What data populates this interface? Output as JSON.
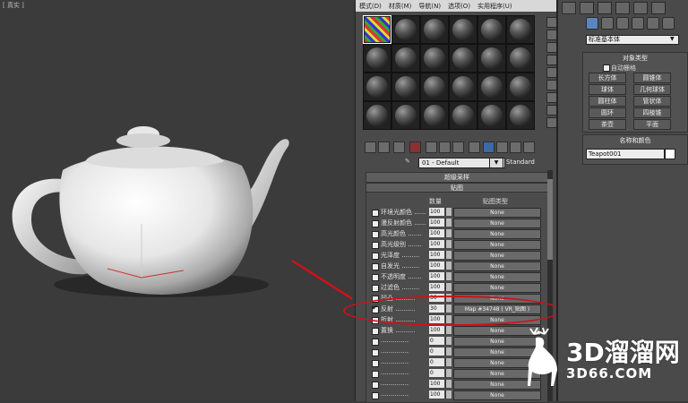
{
  "viewport": {
    "label": "[ 真实 ]"
  },
  "material_editor": {
    "menu": [
      "模式(D)",
      "材质(M)",
      "导航(N)",
      "选项(O)",
      "实用程序(U)"
    ],
    "material_name": "01 - Default",
    "material_type": "Standard",
    "rollouts": {
      "supersampling": "超级采样",
      "maps": "贴图"
    },
    "maps_header": {
      "amount": "数量",
      "map_type": "贴图类型"
    },
    "map_rows": [
      {
        "label": "环境光颜色 ......",
        "amount": "100",
        "map": "None",
        "checked": false
      },
      {
        "label": "漫反射颜色 ......",
        "amount": "100",
        "map": "None",
        "checked": false
      },
      {
        "label": "高光颜色 .......",
        "amount": "100",
        "map": "None",
        "checked": false
      },
      {
        "label": "高光级别 .......",
        "amount": "100",
        "map": "None",
        "checked": false
      },
      {
        "label": "光泽度 .........",
        "amount": "100",
        "map": "None",
        "checked": false
      },
      {
        "label": "自发光 .........",
        "amount": "100",
        "map": "None",
        "checked": false
      },
      {
        "label": "不透明度 .......",
        "amount": "100",
        "map": "None",
        "checked": false
      },
      {
        "label": "过滤色 .........",
        "amount": "100",
        "map": "None",
        "checked": false
      },
      {
        "label": "凹凸 ..........",
        "amount": "30",
        "map": "None",
        "checked": false
      },
      {
        "label": "反射 ..........",
        "amount": "30",
        "map": "Map #34748 ( VR_贴图 )",
        "checked": true
      },
      {
        "label": "折射 ..........",
        "amount": "100",
        "map": "None",
        "checked": false
      },
      {
        "label": "置换 ..........",
        "amount": "100",
        "map": "None",
        "checked": false
      },
      {
        "label": "..............",
        "amount": "0",
        "map": "None",
        "checked": false
      },
      {
        "label": "..............",
        "amount": "0",
        "map": "None",
        "checked": false
      },
      {
        "label": "..............",
        "amount": "0",
        "map": "None",
        "checked": false
      },
      {
        "label": "..............",
        "amount": "0",
        "map": "None",
        "checked": false
      },
      {
        "label": "..............",
        "amount": "100",
        "map": "None",
        "checked": false
      },
      {
        "label": "..............",
        "amount": "100",
        "map": "None",
        "checked": false
      }
    ]
  },
  "command_panel": {
    "category": "标准基本体",
    "object_type_title": "对象类型",
    "autogrid_label": "自动栅格",
    "object_buttons": [
      "长方体",
      "圆锥体",
      "球体",
      "几何球体",
      "圆柱体",
      "管状体",
      "圆环",
      "四棱锥",
      "茶壶",
      "平面"
    ],
    "name_color_title": "名称和颜色",
    "object_name": "Teapot001",
    "object_color": "#ffffff"
  },
  "watermark": {
    "brand": "3D溜溜网",
    "url": "3D66.COM"
  }
}
